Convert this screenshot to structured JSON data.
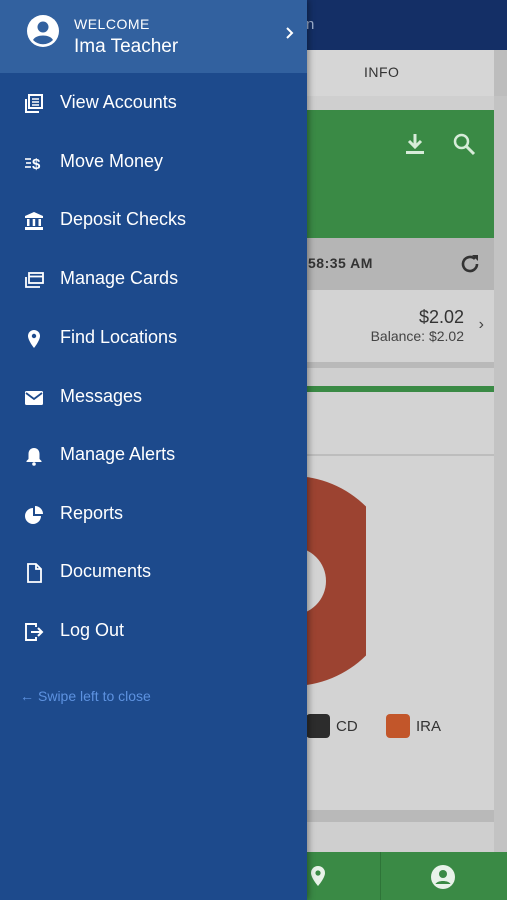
{
  "background": {
    "title_fragment": "n",
    "tab": "INFO",
    "refresh_time": "58:35 AM",
    "account_amount": "$2.02",
    "account_balance": "Balance: $2.02",
    "legend": [
      {
        "label": "CD",
        "color": "#2c2c2c"
      },
      {
        "label": "IRA",
        "color": "#c2562a"
      }
    ]
  },
  "drawer": {
    "welcome": "WELCOME",
    "user_name": "Ima Teacher",
    "items": [
      {
        "label": "View Accounts",
        "icon": "accounts-icon"
      },
      {
        "label": "Move Money",
        "icon": "transfer-icon"
      },
      {
        "label": "Deposit Checks",
        "icon": "bank-icon"
      },
      {
        "label": "Manage Cards",
        "icon": "cards-icon"
      },
      {
        "label": "Find Locations",
        "icon": "location-pin-icon"
      },
      {
        "label": "Messages",
        "icon": "mail-icon"
      },
      {
        "label": "Manage Alerts",
        "icon": "bell-icon"
      },
      {
        "label": "Reports",
        "icon": "pie-chart-icon"
      },
      {
        "label": "Documents",
        "icon": "document-icon"
      },
      {
        "label": "Log Out",
        "icon": "logout-icon"
      }
    ],
    "swipe_hint": "Swipe left to close"
  },
  "colors": {
    "drawer_bg": "#1d4a8c",
    "header_bg": "#32619f",
    "accent_green": "#3a8a45",
    "swipe_text": "#5d92e0"
  }
}
